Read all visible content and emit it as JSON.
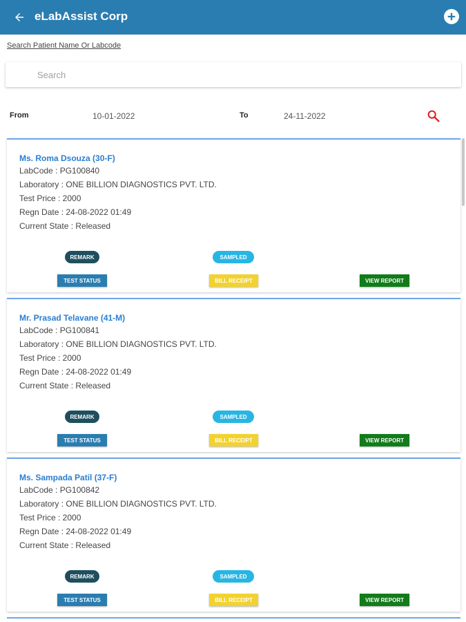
{
  "appbar": {
    "title": "eLabAssist Corp",
    "color": "#2a7db0",
    "back_icon": "arrow-left-icon",
    "add_icon": "plus-circle-icon"
  },
  "search": {
    "label": "Search Patient Name Or Labcode",
    "placeholder": "Search",
    "value": ""
  },
  "filters": {
    "from_label": "From",
    "from_value": "10-01-2022",
    "to_label": "To",
    "to_value": "24-11-2022",
    "search_icon": "magnifier-icon",
    "search_icon_color": "#e02020"
  },
  "records": [
    {
      "name": "Ms. Roma Dsouza  (30-F)",
      "labcode": "LabCode : PG100840",
      "laboratory": "Laboratory : ONE BILLION DIAGNOSTICS PVT. LTD.",
      "price": "Test Price : 2000",
      "regn_date": "Regn Date : 24-08-2022 01:49",
      "state": "Current State : Released"
    },
    {
      "name": "Mr. Prasad Telavane  (41-M)",
      "labcode": "LabCode : PG100841",
      "laboratory": "Laboratory : ONE BILLION DIAGNOSTICS PVT. LTD.",
      "price": "Test Price : 2000",
      "regn_date": "Regn Date : 24-08-2022 01:49",
      "state": "Current State : Released"
    },
    {
      "name": "Ms. Sampada Patil  (37-F)",
      "labcode": "LabCode : PG100842",
      "laboratory": "Laboratory : ONE BILLION DIAGNOSTICS PVT. LTD.",
      "price": "Test Price : 2000",
      "regn_date": "Regn Date : 24-08-2022 01:49",
      "state": "Current State : Released"
    }
  ],
  "card_actions": {
    "remark": "REMARK",
    "sampled": "SAMPLED",
    "test_status": "TEST STATUS",
    "bill_receipt": "BILL RECEIPT",
    "view_report": "VIEW REPORT"
  },
  "colors": {
    "remark": "#1f4f5f",
    "sampled": "#27b6e3",
    "test_status": "#2a7db0",
    "bill_receipt": "#f2d230",
    "view_report": "#127c1a",
    "patient_name": "#2a7ed0"
  }
}
